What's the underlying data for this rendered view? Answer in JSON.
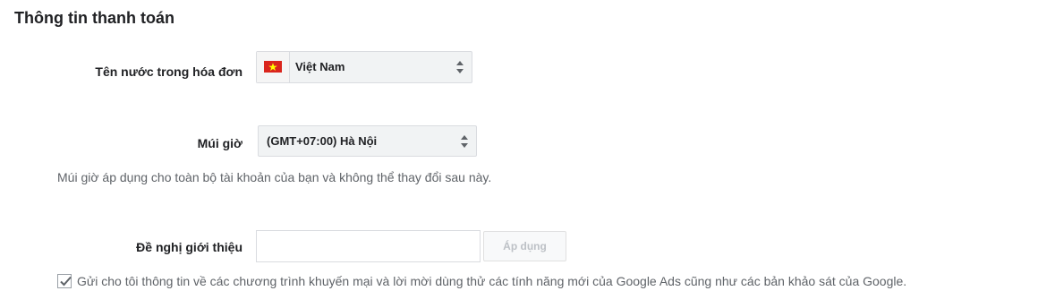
{
  "section": {
    "title": "Thông tin thanh toán"
  },
  "country": {
    "label": "Tên nước trong hóa đơn",
    "value": "Việt Nam",
    "flag_icon": "vietnam-flag-icon"
  },
  "timezone": {
    "label": "Múi giờ",
    "value": "(GMT+07:00) Hà Nội",
    "help_text": "Múi giờ áp dụng cho toàn bộ tài khoản của bạn và không thể thay đổi sau này."
  },
  "promo": {
    "label": "Đề nghị giới thiệu",
    "input_value": "",
    "input_placeholder": "",
    "apply_label": "Áp dụng"
  },
  "marketing": {
    "checked": true,
    "label": "Gửi cho tôi thông tin về các chương trình khuyến mại và lời mời dùng thử các tính năng mới của Google Ads cũng như các bản khảo sát của Google."
  },
  "colors": {
    "flag_red": "#da251d",
    "flag_star": "#ffff00",
    "disabled_text": "#bdc1c6",
    "help_text": "#5f6368"
  }
}
